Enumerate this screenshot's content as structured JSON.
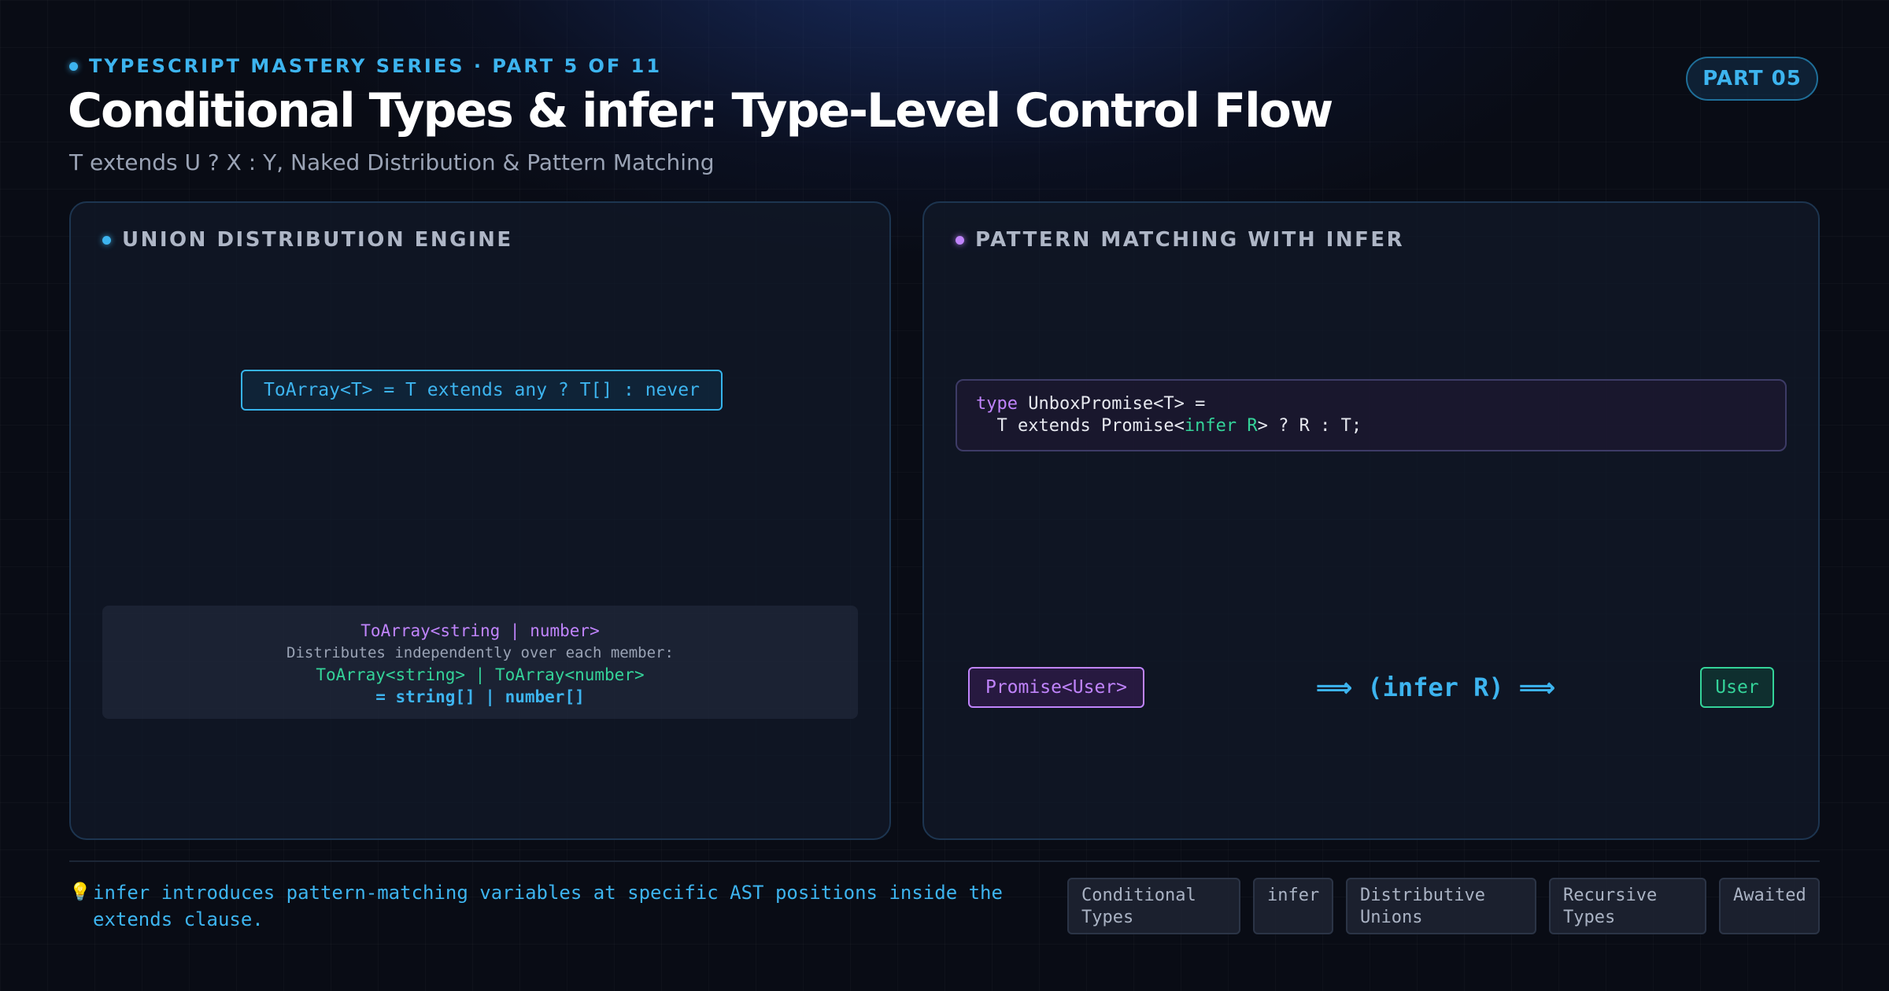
{
  "header": {
    "eyebrow": "TYPESCRIPT MASTERY SERIES · PART 5 OF 11",
    "title": "Conditional Types & infer: Type-Level Control Flow",
    "subtitle": "T extends U ? X : Y, Naked Distribution & Pattern Matching",
    "badge": "PART 05"
  },
  "left_panel": {
    "title": "UNION DISTRIBUTION ENGINE",
    "formula": "ToArray<T> = T extends any ? T[] : never",
    "distribution": {
      "line1": "ToArray<string | number>",
      "line2": "Distributes independently over each member:",
      "line3": "ToArray<string> | ToArray<number>",
      "line4": "= string[] | number[]"
    }
  },
  "right_panel": {
    "title": "PATTERN MATCHING WITH INFER",
    "code": {
      "kw_type": "type",
      "line1_rest": " UnboxPromise<T> =",
      "line2_a": "  T extends Promise<",
      "line2_infer": "infer R",
      "line2_b": "> ? R : T;"
    },
    "input_chip": "Promise<User>",
    "arrow_label": "⟹ (infer R) ⟹",
    "output_chip": "User"
  },
  "footer": {
    "tip_icon": "lightbulb-icon",
    "tip_glyph": "💡",
    "tip": "infer introduces pattern-matching variables at specific AST positions inside the extends clause.",
    "tags": [
      {
        "line1": "Conditional",
        "line2": "Types"
      },
      {
        "line1": "infer",
        "line2": ""
      },
      {
        "line1": "Distributive",
        "line2": "Unions"
      },
      {
        "line1": "Recursive",
        "line2": "Types"
      },
      {
        "line1": "Awaited",
        "line2": ""
      }
    ]
  },
  "colors": {
    "accent_blue": "#3db4ef",
    "accent_purple": "#c084fc",
    "accent_green": "#34d399",
    "background": "#090c15"
  }
}
